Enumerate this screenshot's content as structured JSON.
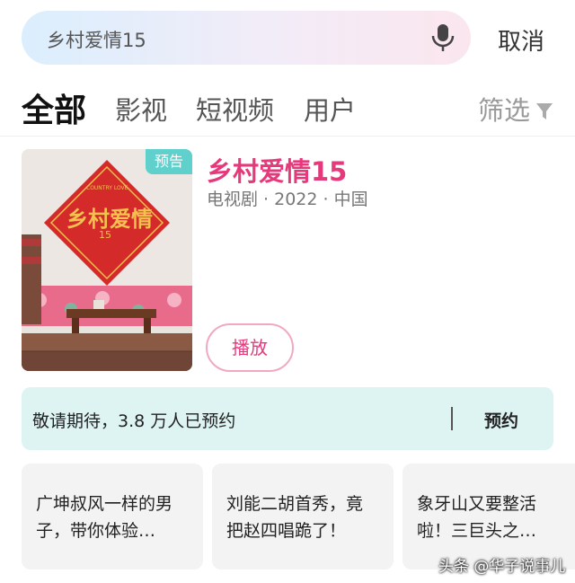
{
  "search": {
    "query": "乡村爱情15",
    "cancel_label": "取消"
  },
  "tabs": [
    {
      "label": "全部",
      "active": true
    },
    {
      "label": "影视",
      "active": false
    },
    {
      "label": "短视频",
      "active": false
    },
    {
      "label": "用户",
      "active": false
    }
  ],
  "filter_label": "筛选",
  "result": {
    "badge": "预告",
    "title": "乡村爱情15",
    "meta": "电视剧 · 2022 · 中国",
    "play_label": "播放",
    "poster_text": "乡村爱情",
    "poster_subtext": "COUNTRY LOVE",
    "poster_number": "15"
  },
  "reservation": {
    "text": "敬请期待，3.8 万人已预约",
    "button": "预约"
  },
  "suggestions": [
    {
      "text": "广坤叔风一样的男子，带你体验…"
    },
    {
      "text": "刘能二胡首秀，竟把赵四唱跪了！"
    },
    {
      "text": "象牙山又要整活啦！三巨头之…"
    }
  ],
  "watermark": "头条 @华子说事儿",
  "colors": {
    "accent": "#e5397b",
    "badge": "#5fd0cc",
    "reserve_bg": "#ddf4f3"
  }
}
